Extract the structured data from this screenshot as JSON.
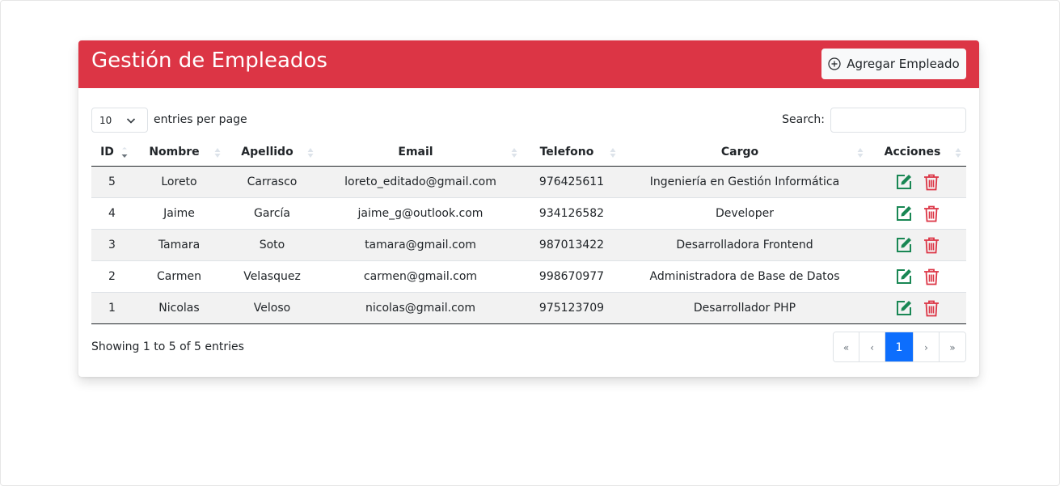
{
  "header": {
    "title": "Gestión de Empleados",
    "add_button_label": "Agregar Empleado"
  },
  "controls": {
    "per_page_value": "10",
    "per_page_label": "entries per page",
    "search_label": "Search:",
    "search_value": ""
  },
  "table": {
    "columns": [
      "ID",
      "Nombre",
      "Apellido",
      "Email",
      "Telefono",
      "Cargo",
      "Acciones"
    ],
    "rows": [
      {
        "id": "5",
        "nombre": "Loreto",
        "apellido": "Carrasco",
        "email": "loreto_editado@gmail.com",
        "telefono": "976425611",
        "cargo": "Ingeniería en Gestión Informática"
      },
      {
        "id": "4",
        "nombre": "Jaime",
        "apellido": "García",
        "email": "jaime_g@outlook.com",
        "telefono": "934126582",
        "cargo": "Developer"
      },
      {
        "id": "3",
        "nombre": "Tamara",
        "apellido": "Soto",
        "email": "tamara@gmail.com",
        "telefono": "987013422",
        "cargo": "Desarrolladora Frontend"
      },
      {
        "id": "2",
        "nombre": "Carmen",
        "apellido": "Velasquez",
        "email": "carmen@gmail.com",
        "telefono": "998670977",
        "cargo": "Administradora de Base de Datos"
      },
      {
        "id": "1",
        "nombre": "Nicolas",
        "apellido": "Veloso",
        "email": "nicolas@gmail.com",
        "telefono": "975123709",
        "cargo": "Desarrollador PHP"
      }
    ]
  },
  "footer": {
    "info": "Showing 1 to 5 of 5 entries",
    "pages": [
      "«",
      "‹",
      "1",
      "›",
      "»"
    ],
    "active_page": "1"
  },
  "colors": {
    "header_bg": "#dc3545",
    "edit_icon": "#198754",
    "delete_icon": "#dc3545",
    "active_page": "#0d6efd"
  },
  "icons": {
    "add": "plus-circle-icon",
    "edit": "edit-icon",
    "delete": "trash-icon",
    "select": "chevron-down-icon",
    "sort": "sort-arrows-icon"
  }
}
